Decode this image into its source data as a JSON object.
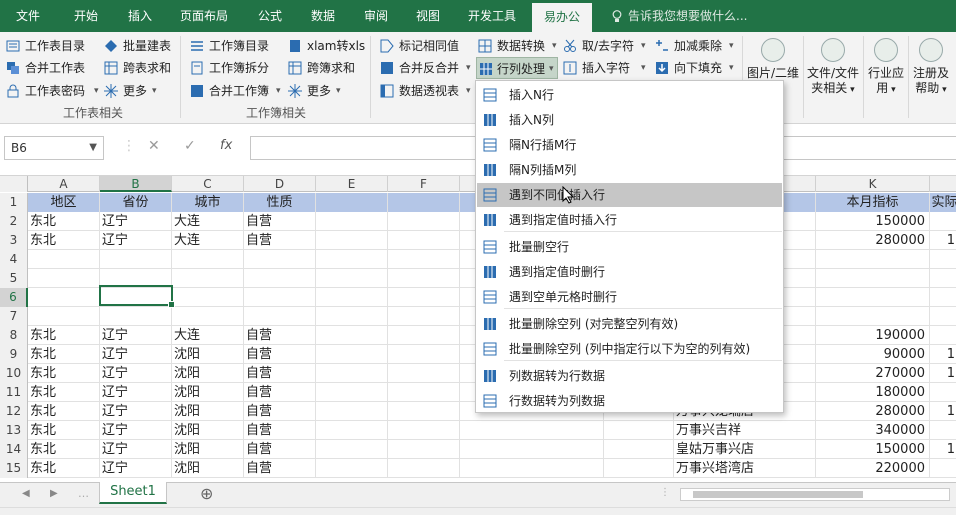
{
  "tabs": [
    "文件",
    "开始",
    "插入",
    "页面布局",
    "公式",
    "数据",
    "审阅",
    "视图",
    "开发工具",
    "易办公"
  ],
  "active_tab": "易办公",
  "tell_me": "告诉我您想要做什么...",
  "ribbon": {
    "group1": {
      "items": [
        "工作表目录",
        "批量建表",
        "合并工作表",
        "跨表求和",
        "工作表密码",
        "更多"
      ],
      "label": "工作表相关"
    },
    "group2": {
      "items": [
        "工作簿目录",
        "xlam转xls",
        "工作簿拆分",
        "跨簿求和",
        "合并工作簿",
        "更多"
      ],
      "label": "工作簿相关"
    },
    "group3": {
      "items": [
        "标记相同值",
        "合并反合并",
        "数据透视表",
        "数据转换",
        "行列处理",
        "取/去字符",
        "插入字符",
        "加减乘除",
        "向下填充"
      ]
    },
    "big": [
      "图片/二维",
      "文件/文件",
      "夹相关",
      "行业应",
      "用",
      "注册及",
      "帮助"
    ]
  },
  "formula_bar": {
    "name_box": "B6",
    "cancel": "✕",
    "confirm": "✓",
    "fx": "fx"
  },
  "columns": [
    "A",
    "B",
    "C",
    "D",
    "E",
    "F",
    "",
    "",
    "K",
    ""
  ],
  "selected_column": "B",
  "rows": [
    {
      "n": "1",
      "a": "地区",
      "b": "省份",
      "c": "城市",
      "d": "性质",
      "k": "本月指标",
      "l": "实际"
    },
    {
      "n": "2",
      "a": "东北",
      "b": "辽宁",
      "c": "大连",
      "d": "自营",
      "k": "150000",
      "l": ""
    },
    {
      "n": "3",
      "a": "东北",
      "b": "辽宁",
      "c": "大连",
      "d": "自营",
      "k": "280000",
      "l": "1"
    },
    {
      "n": "4",
      "a": "",
      "b": "",
      "c": "",
      "d": "",
      "k": "",
      "l": ""
    },
    {
      "n": "5",
      "a": "",
      "b": "",
      "c": "",
      "d": "",
      "k": "",
      "l": ""
    },
    {
      "n": "6",
      "a": "",
      "b": "",
      "c": "",
      "d": "",
      "k": "",
      "l": ""
    },
    {
      "n": "7",
      "a": "",
      "b": "",
      "c": "",
      "d": "",
      "k": "",
      "l": ""
    },
    {
      "n": "8",
      "a": "东北",
      "b": "辽宁",
      "c": "大连",
      "d": "自营",
      "k": "190000",
      "l": ""
    },
    {
      "n": "9",
      "a": "东北",
      "b": "辽宁",
      "c": "沈阳",
      "d": "自营",
      "k": "90000",
      "l": "1"
    },
    {
      "n": "10",
      "a": "东北",
      "b": "辽宁",
      "c": "沈阳",
      "d": "自营",
      "k": "270000",
      "l": "1"
    },
    {
      "n": "11",
      "a": "东北",
      "b": "辽宁",
      "c": "沈阳",
      "d": "自营",
      "k": "180000",
      "l": ""
    },
    {
      "n": "12",
      "a": "东北",
      "b": "辽宁",
      "c": "沈阳",
      "d": "自营",
      "j": "万事兴龙瑞店",
      "k": "280000",
      "l": "1"
    },
    {
      "n": "13",
      "a": "东北",
      "b": "辽宁",
      "c": "沈阳",
      "d": "自营",
      "j": "万事兴吉祥",
      "k": "340000",
      "l": ""
    },
    {
      "n": "14",
      "a": "东北",
      "b": "辽宁",
      "c": "沈阳",
      "d": "自营",
      "j": "皇姑万事兴店",
      "k": "150000",
      "l": "1"
    },
    {
      "n": "15",
      "a": "东北",
      "b": "辽宁",
      "c": "沈阳",
      "d": "自营",
      "j": "万事兴塔湾店",
      "k": "220000",
      "l": ""
    }
  ],
  "menu": [
    "插入N行",
    "插入N列",
    "隔N行插M行",
    "隔N列插M列",
    "遇到不同值插入行",
    "遇到指定值时插入行",
    "批量删空行",
    "遇到指定值时删行",
    "遇到空单元格时删行",
    "批量删除空列 (对完整空列有效)",
    "批量删除空列 (列中指定行以下为空的列有效)",
    "列数据转为行数据",
    "行数据转为列数据"
  ],
  "highlighted_menu_item": "遇到不同值插入行",
  "sheet_tab": "Sheet1",
  "add_sheet": "⊕",
  "colors": {
    "excel_green": "#217346",
    "header_fill": "#b4c6e7"
  }
}
